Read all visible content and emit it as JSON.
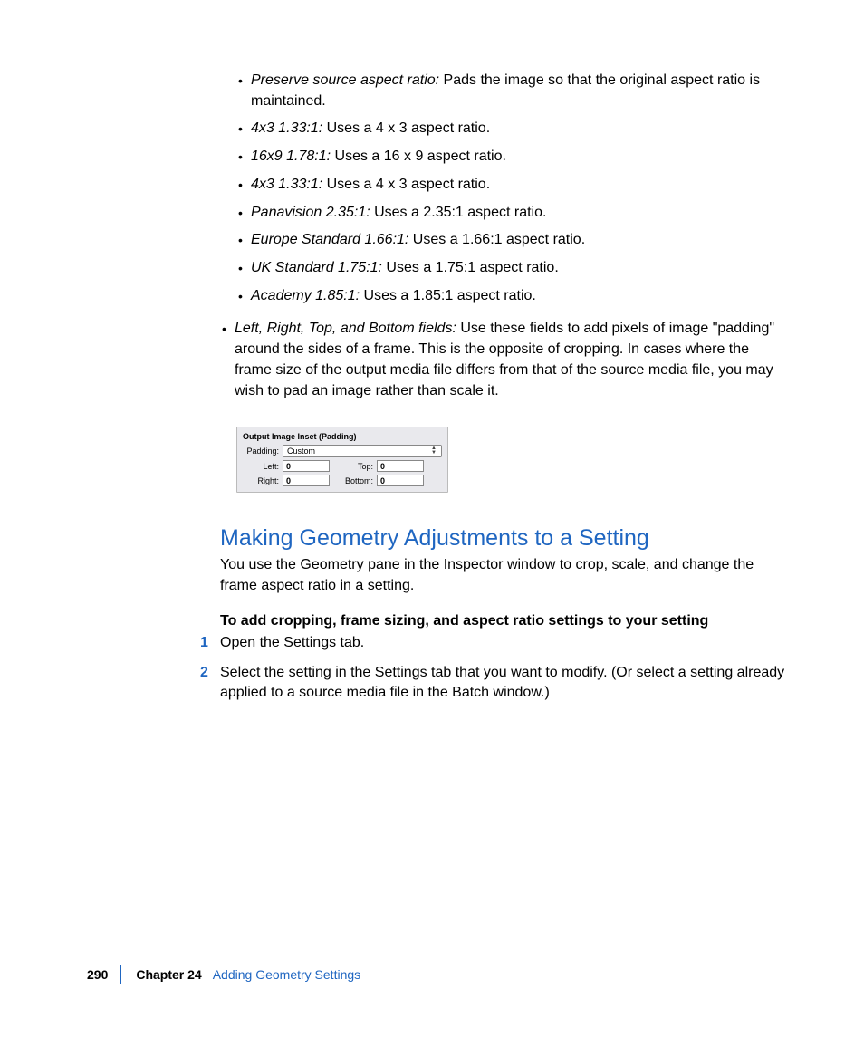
{
  "bullets_inner": [
    {
      "term": "Preserve source aspect ratio:",
      "desc": " Pads the image so that the original aspect ratio is maintained."
    },
    {
      "term": "4x3 1.33:1:",
      "desc": " Uses a 4 x 3 aspect ratio."
    },
    {
      "term": "16x9 1.78:1:",
      "desc": " Uses a 16 x 9 aspect ratio."
    },
    {
      "term": "4x3 1.33:1:",
      "desc": " Uses a 4 x 3 aspect ratio."
    },
    {
      "term": "Panavision 2.35:1:",
      "desc": " Uses a 2.35:1 aspect ratio."
    },
    {
      "term": "Europe Standard 1.66:1:",
      "desc": " Uses a 1.66:1 aspect ratio."
    },
    {
      "term": "UK Standard 1.75:1:",
      "desc": " Uses a 1.75:1 aspect ratio."
    },
    {
      "term": "Academy 1.85:1:",
      "desc": " Uses a 1.85:1 aspect ratio."
    }
  ],
  "bullet_outer": {
    "term": "Left, Right, Top, and Bottom fields:",
    "desc": " Use these fields to add pixels of image \"padding\" around the sides of a frame. This is the opposite of cropping. In cases where the frame size of the output media file differs from that of the source media file, you may wish to pad an image rather than scale it."
  },
  "figure": {
    "title": "Output Image Inset (Padding)",
    "padding_label": "Padding:",
    "padding_value": "Custom",
    "left_label": "Left:",
    "right_label": "Right:",
    "top_label": "Top:",
    "bottom_label": "Bottom:",
    "left_value": "0",
    "right_value": "0",
    "top_value": "0",
    "bottom_value": "0"
  },
  "section_title": "Making Geometry Adjustments to a Setting",
  "section_body": "You use the Geometry pane in the Inspector window to crop, scale, and change the frame aspect ratio in a setting.",
  "lead": "To add cropping, frame sizing, and aspect ratio settings to your setting",
  "steps": [
    "Open the Settings tab.",
    "Select the setting in the Settings tab that you want to modify. (Or select a setting already applied to a source media file in the Batch window.)"
  ],
  "footer": {
    "page": "290",
    "chapter_label": "Chapter 24",
    "chapter_title": "Adding Geometry Settings"
  }
}
